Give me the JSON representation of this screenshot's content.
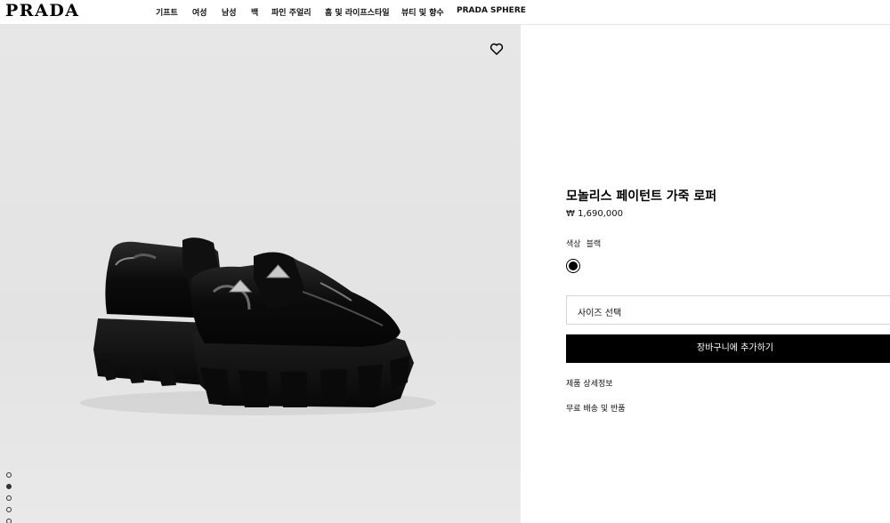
{
  "brand": {
    "logo": "PRADA"
  },
  "nav": {
    "items": [
      {
        "label": "기프트"
      },
      {
        "label": "여성"
      },
      {
        "label": "남성"
      },
      {
        "label": "백"
      },
      {
        "label": "파인 주얼리"
      },
      {
        "label": "홈 및 라이프스타일"
      },
      {
        "label": "뷰티 및 향수"
      },
      {
        "label": "PRADA SPHERE"
      }
    ]
  },
  "gallery": {
    "image_subject": "black patent leather platform loafers",
    "wishlist_icon": "heart-icon",
    "current_index": 2,
    "total_images": 5
  },
  "product": {
    "title": "모놀리스 페이턴트 가죽 로퍼",
    "price": "₩ 1,690,000",
    "color_label": "색상",
    "color_value": "블랙",
    "swatch_color": "#000000",
    "size_placeholder": "사이즈 선택",
    "add_to_cart_label": "장바구니에 추가하기",
    "details_link": "제품 상세정보",
    "shipping_link": "무료 배송 및 반품"
  },
  "colors": {
    "accent": "#000000",
    "background": "#ffffff",
    "image_bg": "#e6e6e6"
  }
}
